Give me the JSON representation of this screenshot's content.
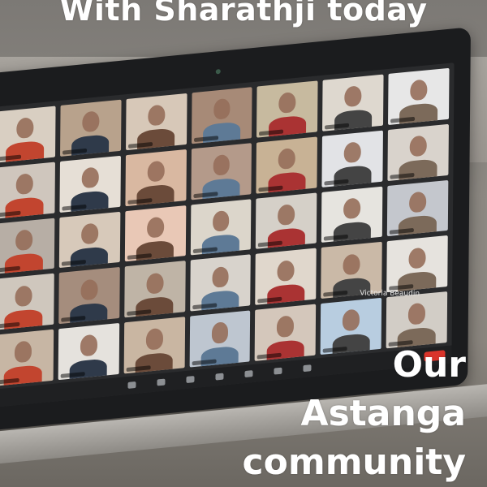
{
  "caption": {
    "top": "With Sharathji today",
    "bottom_lines": [
      "Our",
      "Astanga",
      "community"
    ]
  },
  "laptop": {
    "visible_participant_name": "Victoria Beaudin"
  },
  "colors": {
    "caption_text": "#ffffff",
    "end_button": "#d9342b",
    "laptop_bezel": "#1b1c1e"
  },
  "gallery": {
    "tiles": [
      "#d9cfc2",
      "#b8a28c",
      "#d7c8b8",
      "#a78a77",
      "#c7ba9f",
      "#ded8cf",
      "#e7e7e7",
      "#cfc6bd",
      "#e6dfd6",
      "#d9b8a1",
      "#b49a8a",
      "#c8b295",
      "#e2e3e6",
      "#d9d3cc",
      "#b7aea5",
      "#d7c9ba",
      "#e9c8b6",
      "#dcd6cb",
      "#d5d0c8",
      "#e6e4df",
      "#c4c7cd",
      "#cfc7bd",
      "#a58d7d",
      "#bfb4a6",
      "#d8d3cc",
      "#e0d7cc",
      "#cab9a7",
      "#e6e3de",
      "#c7b6a4",
      "#e5e2dd",
      "#c9b6a2",
      "#bec6d0",
      "#d4c7bb",
      "#b8cde0",
      "#d2cdc6"
    ]
  }
}
